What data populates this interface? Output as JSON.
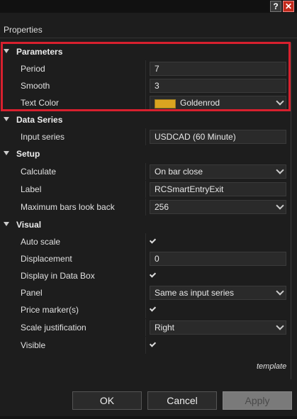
{
  "window": {
    "help_label": "?",
    "close_label": "✕"
  },
  "header": {
    "title": "Properties"
  },
  "categories": {
    "parameters": "Parameters",
    "data_series": "Data Series",
    "setup": "Setup",
    "visual": "Visual"
  },
  "parameters": {
    "period": {
      "label": "Period",
      "value": "7"
    },
    "smooth": {
      "label": "Smooth",
      "value": "3"
    },
    "text_color": {
      "label": "Text Color",
      "value": "Goldenrod",
      "swatch": "#daa520"
    }
  },
  "data_series": {
    "input_series": {
      "label": "Input series",
      "value": "USDCAD (60 Minute)"
    }
  },
  "setup": {
    "calculate": {
      "label": "Calculate",
      "value": "On bar close"
    },
    "label": {
      "label": "Label",
      "value": "RCSmartEntryExit"
    },
    "max_bars": {
      "label": "Maximum bars look back",
      "value": "256"
    }
  },
  "visual": {
    "auto_scale": {
      "label": "Auto scale",
      "checked": true
    },
    "displacement": {
      "label": "Displacement",
      "value": "0"
    },
    "display_in_data_box": {
      "label": "Display in Data Box",
      "checked": true
    },
    "panel": {
      "label": "Panel",
      "value": "Same as input series"
    },
    "price_markers": {
      "label": "Price marker(s)",
      "checked": true
    },
    "scale_justification": {
      "label": "Scale justification",
      "value": "Right"
    },
    "visible": {
      "label": "Visible",
      "checked": true
    }
  },
  "footer": {
    "template_label": "template",
    "ok_label": "OK",
    "cancel_label": "Cancel",
    "apply_label": "Apply"
  },
  "colors": {
    "highlight": "#d8202e",
    "background": "#1d1d1d",
    "accent": "#daa520"
  }
}
